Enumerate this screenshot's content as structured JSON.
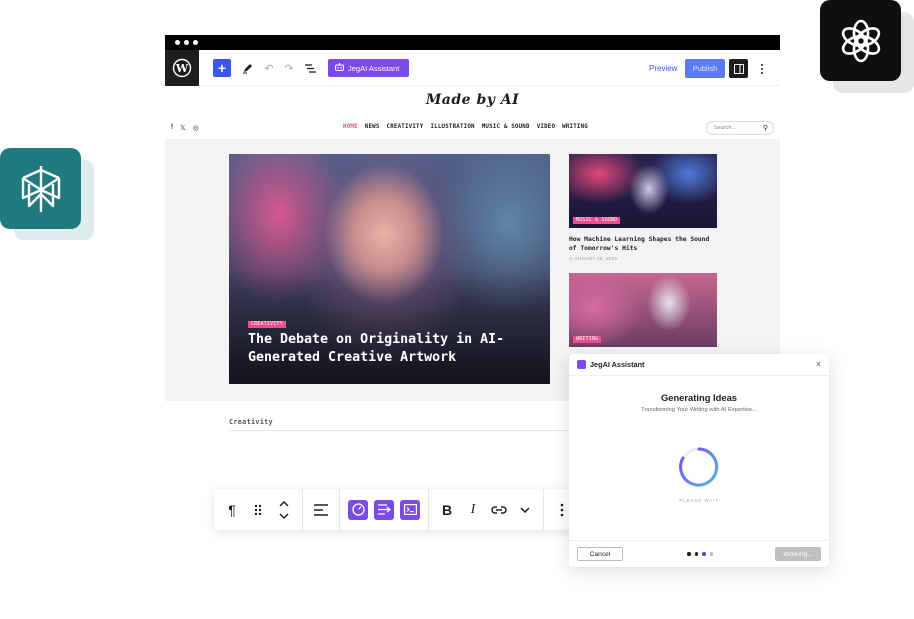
{
  "toolbar": {
    "jegai_label": "JegAI Assistant",
    "preview_label": "Preview",
    "publish_label": "Publish"
  },
  "site": {
    "title": "Made by AI",
    "nav": [
      "HOME",
      "NEWS",
      "CREATIVITY",
      "ILLUSTRATION",
      "MUSIC & SOUND",
      "VIDEO",
      "WRITING"
    ],
    "social": [
      "f",
      "𝕏",
      "◎"
    ],
    "search_placeholder": "Search..."
  },
  "hero": {
    "badge": "CREATIVITY",
    "title": "The Debate on Originality in AI-Generated Creative Artwork"
  },
  "cards": [
    {
      "badge": "MUSIC & SOUND",
      "title": "How Machine Learning Shapes the Sound of Tomorrow's Hits",
      "date": "AUGUST 25, 2025"
    },
    {
      "badge": "WRITING"
    }
  ],
  "section": {
    "heading": "Creativity"
  },
  "modal": {
    "title": "JegAI Assistant",
    "heading": "Generating Ideas",
    "subtitle": "Transforming Your Writing with AI Expertise...",
    "please_wait": "PLEASE WAIT",
    "cancel_label": "Cancel",
    "working_label": "Working..."
  },
  "colors": {
    "accent": "#3858e9",
    "ai_purple": "#7a4be8",
    "badge_pink": "#e8508f",
    "perplexity_teal": "#1f7a80"
  }
}
